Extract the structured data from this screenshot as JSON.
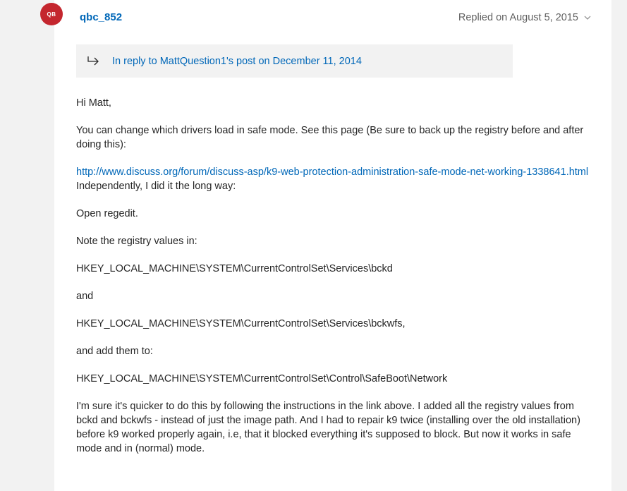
{
  "post": {
    "avatar_initials": "QB",
    "avatar_color": "#c4262e",
    "username": "qbc_852",
    "replied_date": "Replied on August 5, 2015",
    "reply_to": "In reply to MattQuestion1's post on December 11, 2014",
    "link_color": "#0067b8",
    "body": {
      "greeting": "Hi Matt,",
      "p1": "You can change which drivers load in safe mode. See this page (Be sure to back up the registry before and after doing this):",
      "link": "http://www.discuss.org/forum/discuss-asp/k9-web-protection-administration-safe-mode-net-working-1338641.html",
      "p2": "Independently, I did it the long way:",
      "p3": "Open regedit.",
      "p4": "Note the registry values in:",
      "p5": "HKEY_LOCAL_MACHINE\\SYSTEM\\CurrentControlSet\\Services\\bckd",
      "p6": "and",
      "p7": "HKEY_LOCAL_MACHINE\\SYSTEM\\CurrentControlSet\\Services\\bckwfs,",
      "p8": "and add them to:",
      "p9": "HKEY_LOCAL_MACHINE\\SYSTEM\\CurrentControlSet\\Control\\SafeBoot\\Network",
      "p10": "I'm sure it's quicker to do this by following the instructions in the link above. I added all the registry values from bckd and bckwfs - instead of just the image path. And I had to repair k9 twice (installing over the old installation) before k9 worked properly again, i.e, that it blocked everything it's supposed to block. But now it works in safe mode and in (normal) mode."
    }
  },
  "icons": {
    "reply": "reply-arrow-icon",
    "chevron": "chevron-down-icon"
  }
}
